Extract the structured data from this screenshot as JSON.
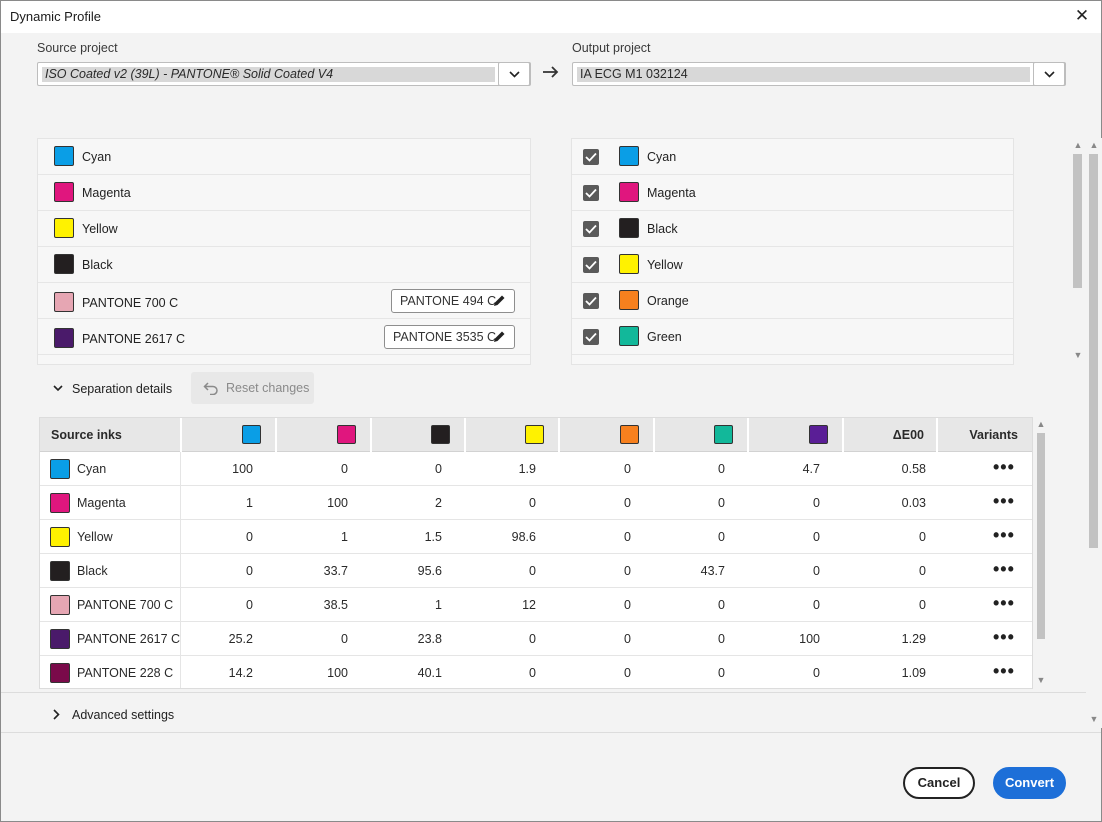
{
  "window": {
    "title": "Dynamic Profile",
    "close_icon": "close-icon"
  },
  "source": {
    "label": "Source project",
    "value": "ISO Coated v2 (39L) - PANTONE® Solid Coated V4"
  },
  "output": {
    "label": "Output project",
    "value": "IA ECG M1 032124"
  },
  "source_inks": [
    {
      "name": "Cyan",
      "color": "#0a9ee6"
    },
    {
      "name": "Magenta",
      "color": "#e0167e"
    },
    {
      "name": "Yellow",
      "color": "#fff200"
    },
    {
      "name": "Black",
      "color": "#231f20"
    },
    {
      "name": "PANTONE 700 C",
      "color": "#e6a6b3",
      "mapping": "PANTONE 494 C"
    },
    {
      "name": "PANTONE 2617 C",
      "color": "#4a1a6a",
      "mapping": "PANTONE 3535 C"
    }
  ],
  "output_inks": [
    {
      "name": "Cyan",
      "color": "#0a9ee6",
      "checked": true
    },
    {
      "name": "Magenta",
      "color": "#e0167e",
      "checked": true
    },
    {
      "name": "Black",
      "color": "#231f20",
      "checked": true
    },
    {
      "name": "Yellow",
      "color": "#fff200",
      "checked": true
    },
    {
      "name": "Orange",
      "color": "#f7801e",
      "checked": true
    },
    {
      "name": "Green",
      "color": "#12b89a",
      "checked": true
    }
  ],
  "separation": {
    "toggle_label": "Separation details",
    "reset_label": "Reset changes"
  },
  "table": {
    "header_first": "Source inks",
    "column_colors": [
      "#0a9ee6",
      "#e0167e",
      "#231f20",
      "#fff200",
      "#f7801e",
      "#12b89a",
      "#5a1e96"
    ],
    "header_delta": "ΔE00",
    "header_variants": "Variants",
    "rows": [
      {
        "name": "Cyan",
        "color": "#0a9ee6",
        "values": [
          "100",
          "0",
          "0",
          "1.9",
          "0",
          "0",
          "4.7"
        ],
        "delta": "0.58"
      },
      {
        "name": "Magenta",
        "color": "#e0167e",
        "values": [
          "1",
          "100",
          "2",
          "0",
          "0",
          "0",
          "0"
        ],
        "delta": "0.03"
      },
      {
        "name": "Yellow",
        "color": "#fff200",
        "values": [
          "0",
          "1",
          "1.5",
          "98.6",
          "0",
          "0",
          "0"
        ],
        "delta": "0"
      },
      {
        "name": "Black",
        "color": "#231f20",
        "values": [
          "0",
          "33.7",
          "95.6",
          "0",
          "0",
          "43.7",
          "0"
        ],
        "delta": "0"
      },
      {
        "name": "PANTONE 700 C",
        "color": "#e6a6b3",
        "values": [
          "0",
          "38.5",
          "1",
          "12",
          "0",
          "0",
          "0"
        ],
        "delta": "0"
      },
      {
        "name": "PANTONE 2617 C",
        "color": "#4a1a6a",
        "values": [
          "25.2",
          "0",
          "23.8",
          "0",
          "0",
          "0",
          "100"
        ],
        "delta": "1.29"
      },
      {
        "name": "PANTONE 228 C",
        "color": "#7a0a4a",
        "values": [
          "14.2",
          "100",
          "40.1",
          "0",
          "0",
          "0",
          "0"
        ],
        "delta": "1.09"
      }
    ],
    "variants_glyph": "•••"
  },
  "advanced": {
    "label": "Advanced settings"
  },
  "footer": {
    "cancel_label": "Cancel",
    "convert_label": "Convert"
  }
}
